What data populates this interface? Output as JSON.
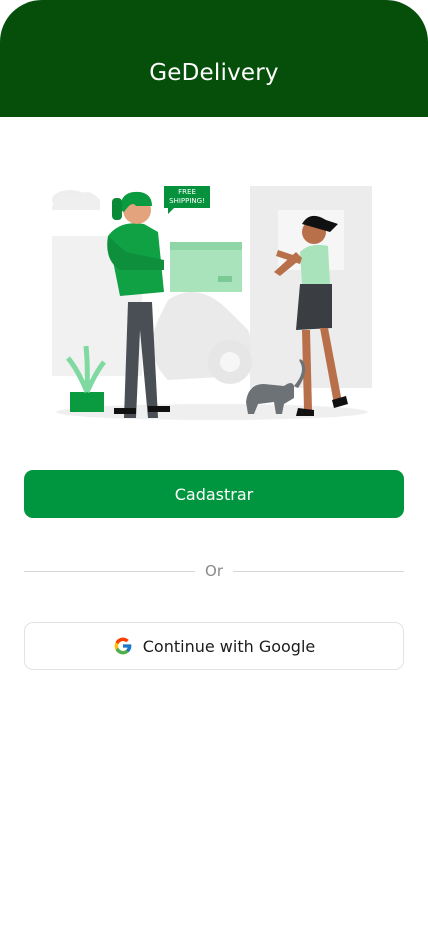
{
  "header": {
    "title": "GeDelivery"
  },
  "illustration": {
    "badge_line1": "FREE",
    "badge_line2": "SHIPPING!"
  },
  "actions": {
    "register_label": "Cadastrar",
    "divider_label": "Or",
    "google_label": "Continue with Google"
  },
  "colors": {
    "header": "#064f0a",
    "primary": "#00963f",
    "border": "#e3e3e3"
  },
  "icons": {
    "google": "google-g-icon"
  }
}
